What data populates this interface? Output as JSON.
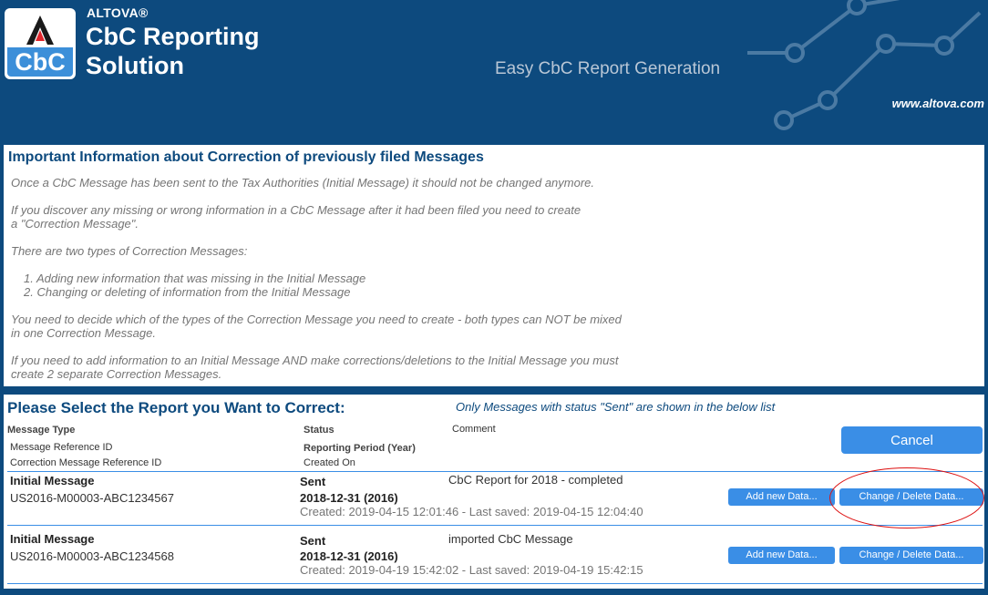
{
  "brand": {
    "company": "ALTOVA®",
    "product_line1": "CbC Reporting",
    "product_line2": "Solution",
    "logo_text": "CbC",
    "tagline": "Easy CbC Report Generation",
    "website": "www.altova.com"
  },
  "info": {
    "title": "Important Information about Correction of previously filed Messages",
    "p1": "Once a CbC Message has been sent to the Tax Authorities (Initial Message) it should not be changed anymore.",
    "p2": "If you discover any missing or wrong information in a CbC Message after it had been filed you need to create a \"Correction Message\".",
    "p3": "There are two types of Correction Messages:",
    "list": [
      "1. Adding new information that was missing in the Initial Message",
      "2. Changing or deleting of information from the Initial Message"
    ],
    "p4": "You need to decide which of the types of the Correction Message you need to create - both types can NOT be mixed in one Correction Message.",
    "p5": "If you need to add information to an Initial Message AND make corrections/deletions to the Initial Message you must create 2 separate Correction Messages."
  },
  "report": {
    "title": "Please Select the Report you Want to Correct:",
    "note": "Only Messages with status \"Sent\" are shown in the below list",
    "headers": {
      "message_type": "Message Type",
      "message_ref": "Message Reference ID",
      "correction_ref": "Correction Message Reference ID",
      "status": "Status",
      "period": "Reporting Period (Year)",
      "created": "Created On",
      "comment": "Comment"
    },
    "cancel_label": "Cancel",
    "add_label": "Add new Data...",
    "change_label": "Change / Delete Data...",
    "rows": [
      {
        "type": "Initial Message",
        "ref": "US2016-M00003-ABC1234567",
        "status": "Sent",
        "period": "2018-12-31 (2016)",
        "dates": "Created: 2019-04-15 12:01:46 - Last saved: 2019-04-15 12:04:40",
        "comment": "CbC Report for 2018 - completed"
      },
      {
        "type": "Initial Message",
        "ref": "US2016-M00003-ABC1234568",
        "status": "Sent",
        "period": "2018-12-31 (2016)",
        "dates": "Created: 2019-04-19 15:42:02 - Last saved: 2019-04-19 15:42:15",
        "comment": "imported CbC Message"
      }
    ]
  },
  "colors": {
    "header_bg": "#0d4a7e",
    "button": "#3a8ee6",
    "highlight": "#dd1111"
  }
}
